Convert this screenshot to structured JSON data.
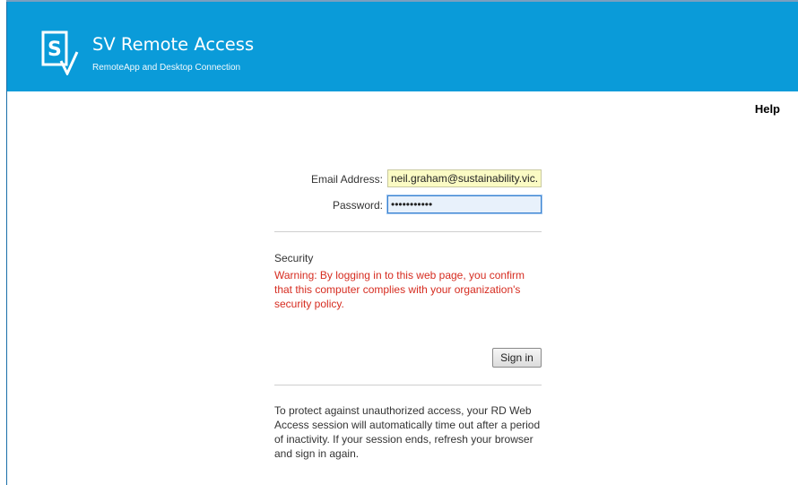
{
  "header": {
    "title": "SV Remote Access",
    "subtitle": "RemoteApp and Desktop Connection",
    "logo_icon": "sv-logo-icon",
    "background_color": "#0a9bd9"
  },
  "nav": {
    "help_label": "Help"
  },
  "login_form": {
    "email_label": "Email Address:",
    "email_value": "neil.graham@sustainability.vic.gov.au",
    "password_label": "Password:",
    "password_value": "•••••••••••",
    "sign_in_label": "Sign in"
  },
  "security": {
    "title": "Security",
    "warning": "Warning: By logging in to this web page, you confirm that this computer complies with your organization's security policy.",
    "warning_color": "#d62c20"
  },
  "info": {
    "timeout_notice": "To protect against unauthorized access, your RD Web Access session will automatically time out after a period of inactivity. If your session ends, refresh your browser and sign in again."
  }
}
